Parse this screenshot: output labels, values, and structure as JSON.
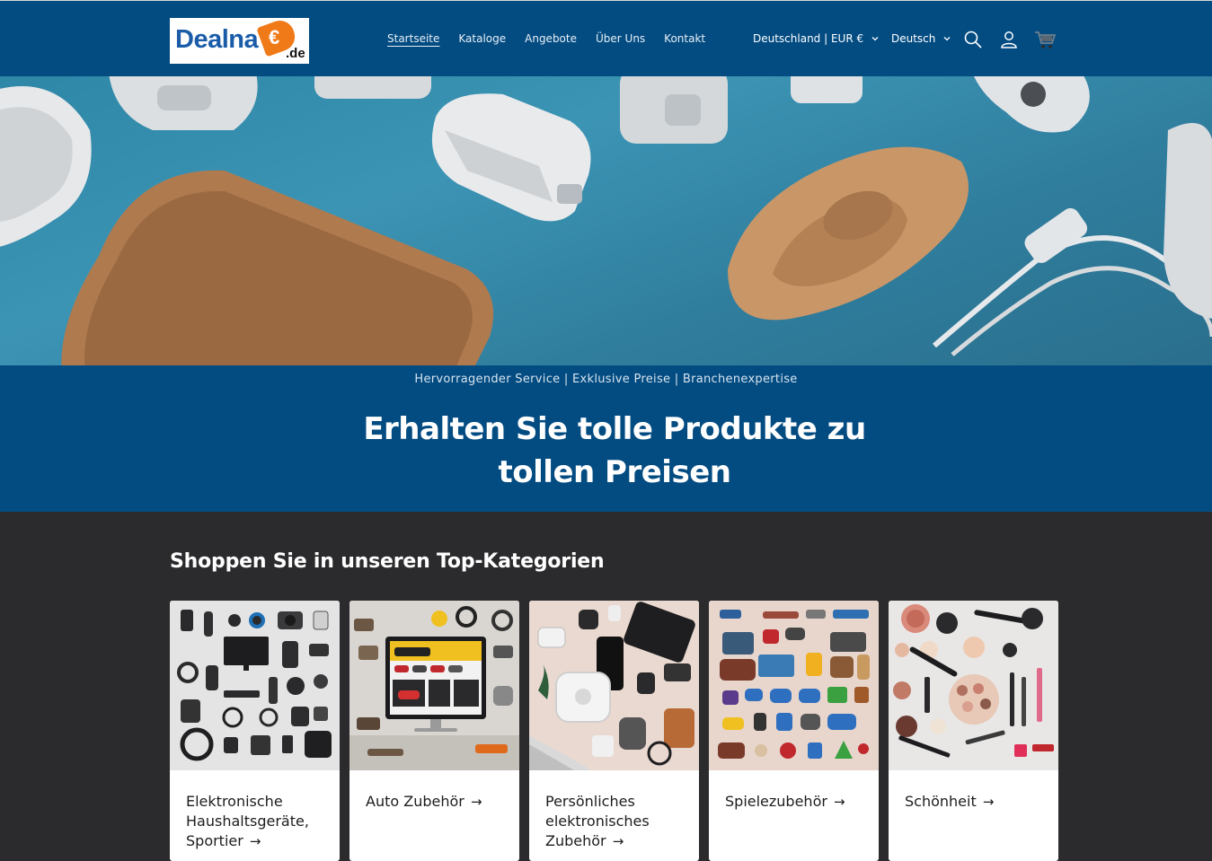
{
  "header": {
    "logo": {
      "word": "Dealna",
      "euro": "€",
      "suffix": ".de"
    },
    "nav": [
      {
        "label": "Startseite",
        "active": true
      },
      {
        "label": "Kataloge",
        "active": false
      },
      {
        "label": "Angebote",
        "active": false
      },
      {
        "label": "Über Uns",
        "active": false
      },
      {
        "label": "Kontakt",
        "active": false
      }
    ],
    "country_selector": "Deutschland | EUR €",
    "language_selector": "Deutsch",
    "icons": [
      "search-icon",
      "account-icon",
      "cart-icon",
      "chevron-down-icon"
    ]
  },
  "banner": {
    "tagline": "Hervorragender Service | Exklusive Preise | Branchenexpertise",
    "headline": "Erhalten Sie tolle Produkte zu tollen Preisen"
  },
  "categories": {
    "title": "Shoppen Sie in unseren Top-Kategorien",
    "items": [
      {
        "label": "Elektronische Haushaltsgeräte, Sportier",
        "arrow": "→"
      },
      {
        "label": "Auto Zubehör",
        "arrow": "→"
      },
      {
        "label": "Persönliches elektronisches Zubehör",
        "arrow": "→"
      },
      {
        "label": "Spielezubehör",
        "arrow": "→"
      },
      {
        "label": "Schönheit",
        "arrow": "→"
      }
    ]
  },
  "colors": {
    "header_bg": "#034c82",
    "page_bg": "#2b2b2d",
    "accent_orange": "#f07a18"
  }
}
